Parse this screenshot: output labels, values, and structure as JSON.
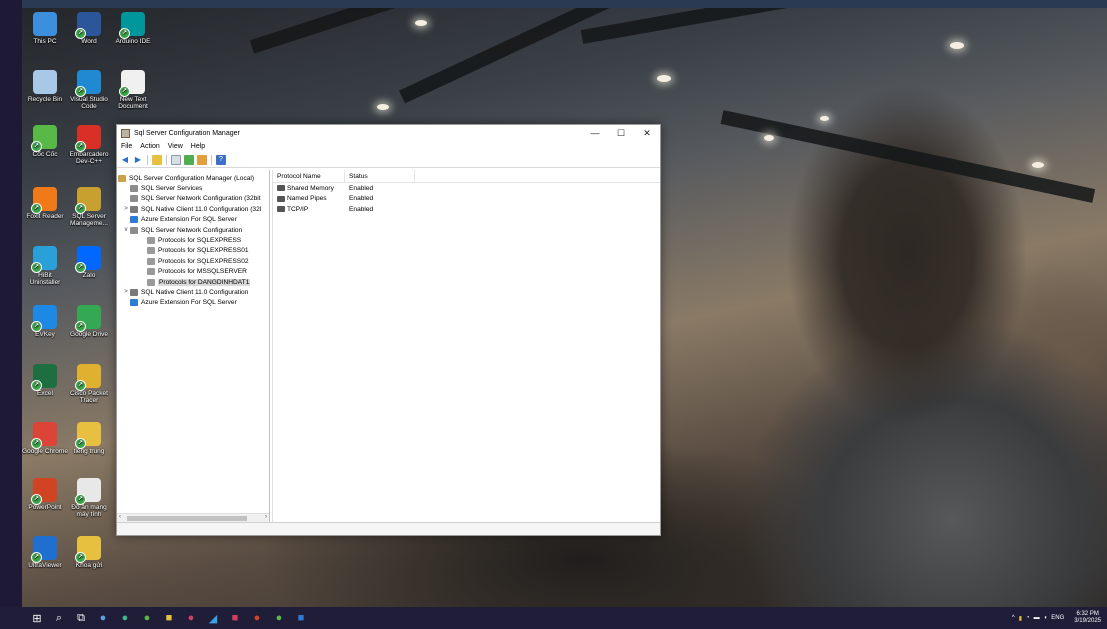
{
  "desktop": {
    "icons": [
      {
        "label": "This PC",
        "icon": "computer-icon",
        "color": "#3c8fdc"
      },
      {
        "label": "Word",
        "icon": "word-icon",
        "color": "#2b579a"
      },
      {
        "label": "Arduino IDE",
        "icon": "arduino-icon",
        "color": "#00979c"
      },
      {
        "label": "Recycle Bin",
        "icon": "recycle-bin-icon",
        "color": "#a8c8e8"
      },
      {
        "label": "Visual Studio Code",
        "icon": "vscode-icon",
        "color": "#1f8ad2"
      },
      {
        "label": "New Text Document",
        "icon": "text-file-icon",
        "color": "#f0f0f0"
      },
      {
        "label": "Cốc Cốc",
        "icon": "coccoc-icon",
        "color": "#58b947"
      },
      {
        "label": "Embarcadero Dev-C++",
        "icon": "devcpp-icon",
        "color": "#d82f26"
      },
      {
        "label": "Foxit Reader",
        "icon": "foxit-icon",
        "color": "#f07a1a"
      },
      {
        "label": "SQL Server Manageme...",
        "icon": "ssms-icon",
        "color": "#c8a030"
      },
      {
        "label": "HiBit Uninstaller",
        "icon": "hibit-icon",
        "color": "#2aa0d8"
      },
      {
        "label": "Zalo",
        "icon": "zalo-icon",
        "color": "#0068ff"
      },
      {
        "label": "EVKey",
        "icon": "evkey-icon",
        "color": "#1e88e5"
      },
      {
        "label": "Google Drive",
        "icon": "google-drive-icon",
        "color": "#34a853"
      },
      {
        "label": "Excel",
        "icon": "excel-icon",
        "color": "#1d6f42"
      },
      {
        "label": "Cisco Packet Tracer",
        "icon": "packet-tracer-icon",
        "color": "#e0b030"
      },
      {
        "label": "Google Chrome",
        "icon": "chrome-icon",
        "color": "#db4437"
      },
      {
        "label": "tiếng trung",
        "icon": "folder-icon",
        "color": "#e8c040"
      },
      {
        "label": "PowerPoint",
        "icon": "powerpoint-icon",
        "color": "#d04423"
      },
      {
        "label": "Đồ án mạng máy tính",
        "icon": "document-icon",
        "color": "#e8e8e8"
      },
      {
        "label": "UltraViewer",
        "icon": "ultraviewer-icon",
        "color": "#1e6fd0"
      },
      {
        "label": "Khoa gửi",
        "icon": "folder-icon",
        "color": "#e8c040"
      }
    ]
  },
  "window": {
    "title": "Sql Server Configuration Manager",
    "controls": {
      "minimize": "—",
      "maximize": "☐",
      "close": "✕"
    },
    "menu": [
      "File",
      "Action",
      "View",
      "Help"
    ],
    "tree": [
      {
        "label": "SQL Server Configuration Manager (Local)",
        "level": 0,
        "expander": "",
        "icon_color": "#c9a24a"
      },
      {
        "label": "SQL Server Services",
        "level": 1,
        "expander": "",
        "icon_color": "#8c8c8c"
      },
      {
        "label": "SQL Server Network Configuration (32bit",
        "level": 1,
        "expander": "",
        "icon_color": "#8c8c8c"
      },
      {
        "label": "SQL Native Client 11.0 Configuration (32l",
        "level": 1,
        "expander": ">",
        "icon_color": "#7a7a7a"
      },
      {
        "label": "Azure Extension For SQL Server",
        "level": 1,
        "expander": "",
        "icon_color": "#2e7bd6"
      },
      {
        "label": "SQL Server Network Configuration",
        "level": 1,
        "expander": "v",
        "icon_color": "#8c8c8c"
      },
      {
        "label": "Protocols for SQLEXPRESS",
        "level": 2,
        "expander": "",
        "icon_color": "#9a9a9a"
      },
      {
        "label": "Protocols for SQLEXPRESS01",
        "level": 2,
        "expander": "",
        "icon_color": "#9a9a9a"
      },
      {
        "label": "Protocols for SQLEXPRESS02",
        "level": 2,
        "expander": "",
        "icon_color": "#9a9a9a"
      },
      {
        "label": "Protocols for MSSQLSERVER",
        "level": 2,
        "expander": "",
        "icon_color": "#9a9a9a"
      },
      {
        "label": "Protocols for DANGDINHDAT1",
        "level": 2,
        "expander": "",
        "icon_color": "#9a9a9a",
        "selected": true
      },
      {
        "label": "SQL Native Client 11.0 Configuration",
        "level": 1,
        "expander": ">",
        "icon_color": "#7a7a7a"
      },
      {
        "label": "Azure Extension For SQL Server",
        "level": 1,
        "expander": "",
        "icon_color": "#2e7bd6"
      }
    ],
    "list": {
      "columns": [
        "Protocol Name",
        "Status"
      ],
      "rows": [
        {
          "name": "Shared Memory",
          "status": "Enabled"
        },
        {
          "name": "Named Pipes",
          "status": "Enabled"
        },
        {
          "name": "TCP/IP",
          "status": "Enabled"
        }
      ]
    }
  },
  "taskbar": {
    "items": [
      {
        "name": "start-button",
        "glyph": "⊞",
        "color": "#ffffff"
      },
      {
        "name": "search-icon",
        "glyph": "⌕",
        "color": "#ffffff"
      },
      {
        "name": "task-view-icon",
        "glyph": "⧉",
        "color": "#ffffff"
      },
      {
        "name": "taskbar-app-1",
        "glyph": "●",
        "color": "#5aa0e0"
      },
      {
        "name": "taskbar-app-2",
        "glyph": "●",
        "color": "#41b883"
      },
      {
        "name": "taskbar-coccoc",
        "glyph": "●",
        "color": "#58b947"
      },
      {
        "name": "taskbar-explorer",
        "glyph": "■",
        "color": "#e8c040"
      },
      {
        "name": "taskbar-app-3",
        "glyph": "●",
        "color": "#d04060"
      },
      {
        "name": "taskbar-app-4",
        "glyph": "◢",
        "color": "#3aa0e8"
      },
      {
        "name": "taskbar-app-5",
        "glyph": "■",
        "color": "#d04060"
      },
      {
        "name": "taskbar-app-6",
        "glyph": "●",
        "color": "#d04423"
      },
      {
        "name": "taskbar-app-7",
        "glyph": "●",
        "color": "#58b947"
      },
      {
        "name": "taskbar-app-8",
        "glyph": "■",
        "color": "#2e7bd6"
      }
    ],
    "tray": {
      "language": "ENG",
      "time": "6:32 PM",
      "date": "3/19/2025"
    }
  }
}
